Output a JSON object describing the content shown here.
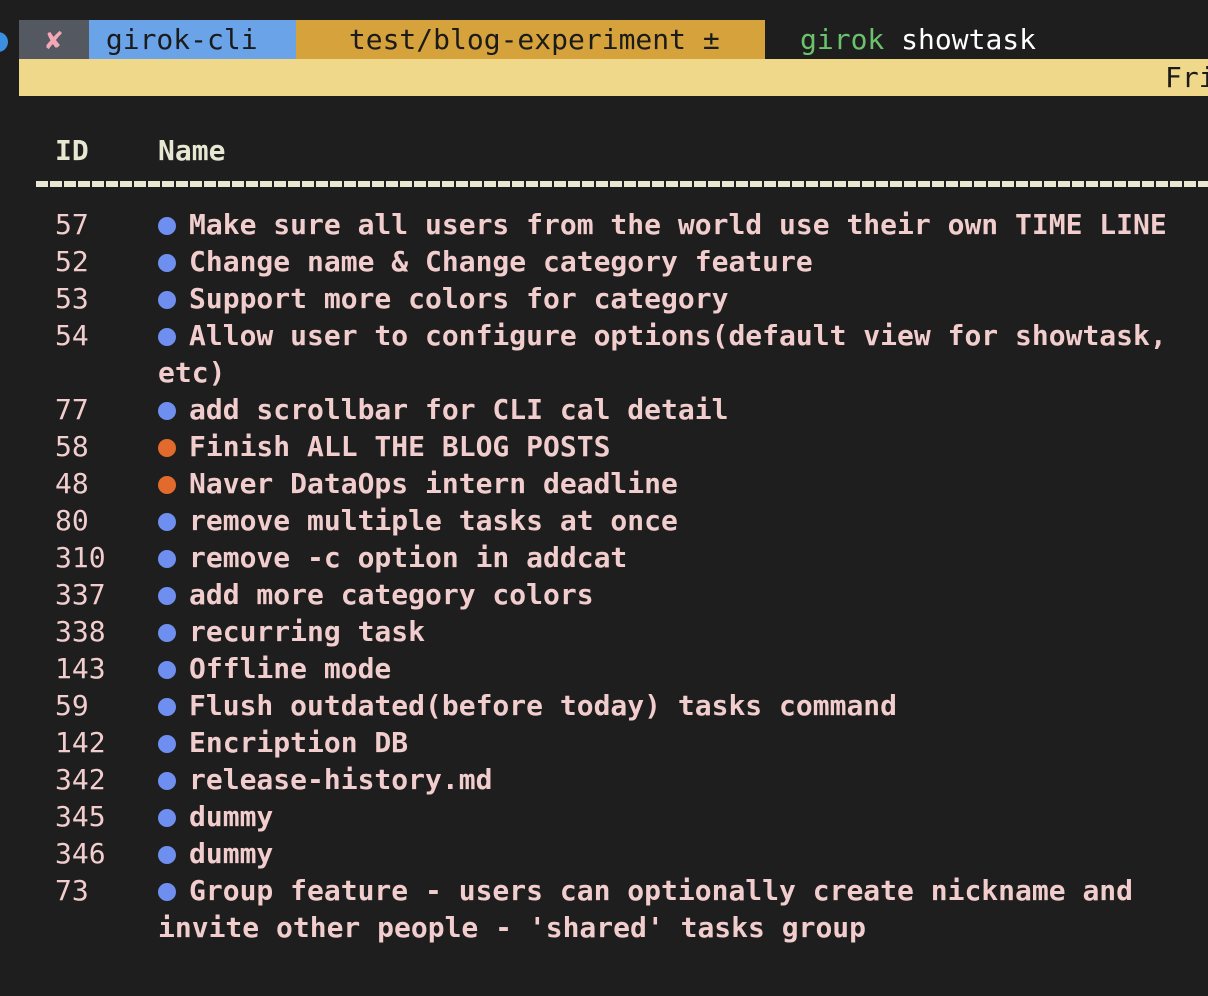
{
  "prompt": {
    "status_icon": "✘",
    "directory_icon": "",
    "directory": "girok-cli",
    "branch_icon": "",
    "branch": "test/blog-experiment ±",
    "separator_icon": "",
    "command": "girok",
    "argument": "showtask"
  },
  "banner": {
    "text": "Fri"
  },
  "table": {
    "id_header": "ID",
    "name_header": "Name",
    "rows": [
      {
        "id": "57",
        "name": "Make sure all users from the world use their own TIME LINE",
        "color": "#6f8ff0"
      },
      {
        "id": "52",
        "name": "Change name & Change category feature",
        "color": "#6f8ff0"
      },
      {
        "id": "53",
        "name": "Support more colors for category",
        "color": "#6f8ff0"
      },
      {
        "id": "54",
        "name": "Allow user to configure options(default view for showtask, etc)",
        "color": "#6f8ff0"
      },
      {
        "id": "77",
        "name": "add scrollbar for CLI cal detail",
        "color": "#6f8ff0"
      },
      {
        "id": "58",
        "name": "Finish ALL THE BLOG POSTS",
        "color": "#e26a2c"
      },
      {
        "id": "48",
        "name": "Naver DataOps intern deadline",
        "color": "#e26a2c"
      },
      {
        "id": "80",
        "name": "remove multiple tasks at once",
        "color": "#6f8ff0"
      },
      {
        "id": "310",
        "name": "remove -c option in addcat",
        "color": "#6f8ff0"
      },
      {
        "id": "337",
        "name": "add more category colors",
        "color": "#6f8ff0"
      },
      {
        "id": "338",
        "name": "recurring task",
        "color": "#6f8ff0"
      },
      {
        "id": "143",
        "name": "Offline mode",
        "color": "#6f8ff0"
      },
      {
        "id": "59",
        "name": "Flush outdated(before today) tasks command",
        "color": "#6f8ff0"
      },
      {
        "id": "142",
        "name": "Encription DB",
        "color": "#6f8ff0"
      },
      {
        "id": "342",
        "name": "release-history.md",
        "color": "#6f8ff0"
      },
      {
        "id": "345",
        "name": "dummy",
        "color": "#6f8ff0"
      },
      {
        "id": "346",
        "name": "dummy",
        "color": "#6f8ff0"
      },
      {
        "id": "73",
        "name": "Group feature - users can optionally create nickname and invite other people - 'shared' tasks group",
        "color": "#6f8ff0"
      }
    ]
  }
}
